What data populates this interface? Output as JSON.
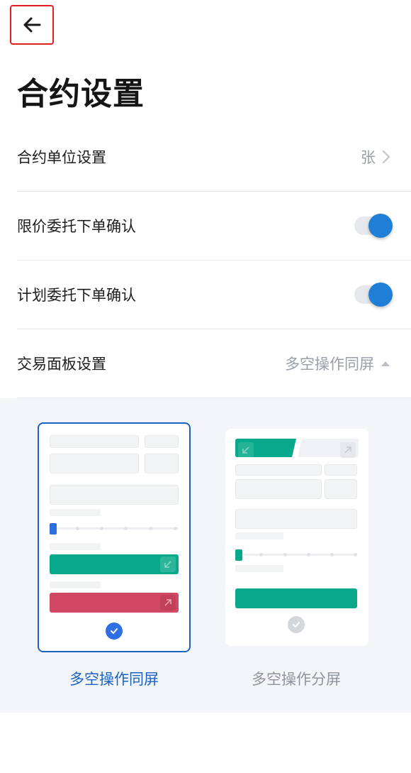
{
  "header": {
    "title": "合约设置"
  },
  "settings": {
    "unit": {
      "label": "合约单位设置",
      "value": "张"
    },
    "limit_confirm": {
      "label": "限价委托下单确认",
      "enabled": true
    },
    "plan_confirm": {
      "label": "计划委托下单确认",
      "enabled": true
    },
    "panel": {
      "label": "交易面板设置",
      "value": "多空操作同屏"
    }
  },
  "panel_options": [
    {
      "label": "多空操作同屏",
      "selected": true
    },
    {
      "label": "多空操作分屏",
      "selected": false
    }
  ],
  "colors": {
    "accent": "#1f7fd6",
    "selected_border": "#1a63c4",
    "buy": "#07a98a",
    "sell": "#d24763",
    "muted": "#9aa0aa"
  },
  "icons": [
    "back-arrow-icon",
    "chevron-right-icon",
    "caret-up-icon",
    "check-circle-icon",
    "arrow-down-left-icon",
    "arrow-up-right-icon"
  ]
}
